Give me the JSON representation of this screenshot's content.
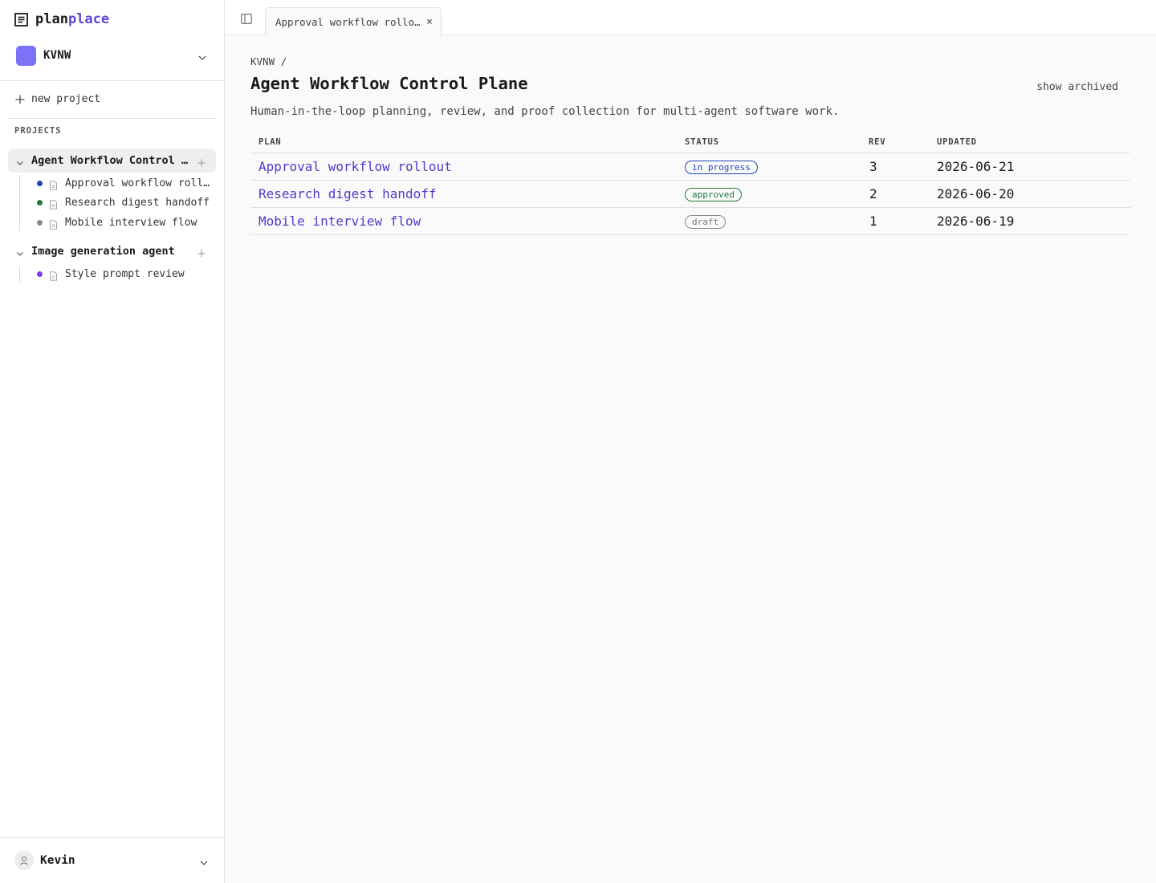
{
  "brand": {
    "part1": "plan",
    "part2": "place"
  },
  "workspace": {
    "name": "KVNW",
    "color": "#7b72f7"
  },
  "sidebar": {
    "new_project_label": "new project",
    "projects_label": "PROJECTS",
    "projects": [
      {
        "name": "Agent Workflow Control Plane",
        "active": true,
        "plans": [
          {
            "label": "Approval workflow rollout",
            "dot_color": "#1e48b5"
          },
          {
            "label": "Research digest handoff",
            "dot_color": "#1f7a3a"
          },
          {
            "label": "Mobile interview flow",
            "dot_color": "#888888"
          }
        ]
      },
      {
        "name": "Image generation agent",
        "active": false,
        "plans": [
          {
            "label": "Style prompt review",
            "dot_color": "#7a3fe0"
          }
        ]
      }
    ]
  },
  "user": {
    "name": "Kevin"
  },
  "tabs": [
    {
      "label": "Approval workflow rollout"
    }
  ],
  "tab_close": "×",
  "breadcrumb": "KVNW /",
  "page": {
    "title": "Agent Workflow Control Plane",
    "description": "Human-in-the-loop planning, review, and proof collection for multi-agent software work.",
    "show_archived_label": "show archived"
  },
  "table": {
    "columns": {
      "plan": "PLAN",
      "status": "STATUS",
      "rev": "REV",
      "updated": "UPDATED"
    },
    "rows": [
      {
        "plan": "Approval workflow rollout",
        "status": "in progress",
        "status_kind": "in-progress",
        "rev": "3",
        "updated": "2026-06-21"
      },
      {
        "plan": "Research digest handoff",
        "status": "approved",
        "status_kind": "approved",
        "rev": "2",
        "updated": "2026-06-20"
      },
      {
        "plan": "Mobile interview flow",
        "status": "draft",
        "status_kind": "draft",
        "rev": "1",
        "updated": "2026-06-19"
      }
    ]
  },
  "colors": {
    "accent": "#5b46d6",
    "link": "#4b3dc9"
  }
}
